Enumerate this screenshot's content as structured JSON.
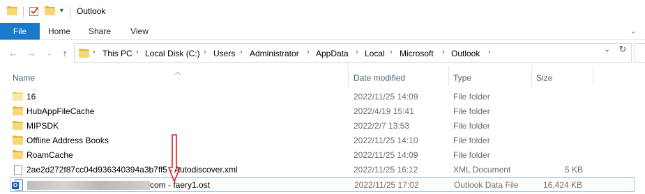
{
  "window": {
    "title": "Outlook"
  },
  "ribbon": {
    "tabs": [
      "File",
      "Home",
      "Share",
      "View"
    ]
  },
  "address": {
    "crumbs": [
      "This PC",
      "Local Disk (C:)",
      "Users",
      "Administrator",
      "AppData",
      "Local",
      "Microsoft",
      "Outlook"
    ]
  },
  "columns": {
    "name": "Name",
    "date": "Date modified",
    "type": "Type",
    "size": "Size"
  },
  "files": [
    {
      "icon": "folder-icon",
      "name": "16",
      "date": "2022/11/25 14:09",
      "type": "File folder",
      "size": ""
    },
    {
      "icon": "folder-icon",
      "name": "HubAppFileCache",
      "date": "2022/4/19 15:41",
      "type": "File folder",
      "size": ""
    },
    {
      "icon": "folder-icon",
      "name": "MIPSDK",
      "date": "2022/2/7 13:53",
      "type": "File folder",
      "size": ""
    },
    {
      "icon": "folder-icon",
      "name": "Offline Address Books",
      "date": "2022/11/25 14:10",
      "type": "File folder",
      "size": ""
    },
    {
      "icon": "folder-icon",
      "name": "RoamCache",
      "date": "2022/11/25 14:09",
      "type": "File folder",
      "size": ""
    },
    {
      "icon": "xml-file-icon",
      "name": "2ae2d272f87cc04d936340394a3b7ff5 - Autodiscover.xml",
      "date": "2022/11/25 16:12",
      "type": "XML Document",
      "size": "5 KB"
    },
    {
      "icon": "outlook-data-file-icon",
      "name": "com - faery1.ost",
      "date": "2022/11/25 17:02",
      "type": "Outlook Data File",
      "size": "16,424 KB"
    }
  ],
  "colors": {
    "accent": "#1979ca",
    "annotation": "#e02020",
    "selection_border": "#99c9ef"
  }
}
